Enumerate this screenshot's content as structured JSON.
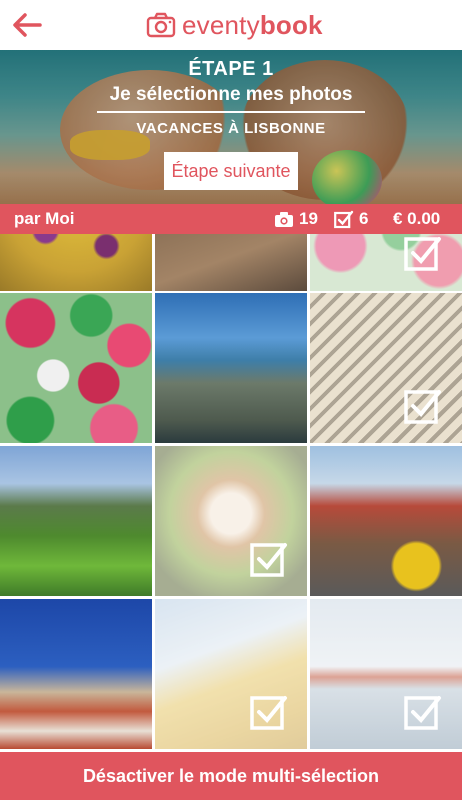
{
  "header": {
    "logo_light": "eventy",
    "logo_bold": "book"
  },
  "hero": {
    "step": "ÉTAPE 1",
    "subtitle": "Je sélectionne mes photos",
    "album": "VACANCES À LISBONNE",
    "next_label": "Étape suivante"
  },
  "infobar": {
    "owner": "par Moi",
    "photo_count": "19",
    "selected_count": "6",
    "price": "€ 0.00"
  },
  "colors": {
    "accent": "#e0555e"
  },
  "photos": [
    {
      "name": "paella",
      "selected": false
    },
    {
      "name": "tram-rails",
      "selected": false
    },
    {
      "name": "umbrellas-top",
      "selected": true
    },
    {
      "name": "umbrellas",
      "selected": false
    },
    {
      "name": "rocky-coast",
      "selected": false
    },
    {
      "name": "glass-roof",
      "selected": true
    },
    {
      "name": "green-valley",
      "selected": false
    },
    {
      "name": "plated-dish",
      "selected": true
    },
    {
      "name": "yellow-tram",
      "selected": false
    },
    {
      "name": "city-rooftops",
      "selected": false
    },
    {
      "name": "arch-building",
      "selected": true
    },
    {
      "name": "bridge",
      "selected": true
    }
  ],
  "bottom": {
    "label": "Désactiver le mode multi-sélection"
  }
}
